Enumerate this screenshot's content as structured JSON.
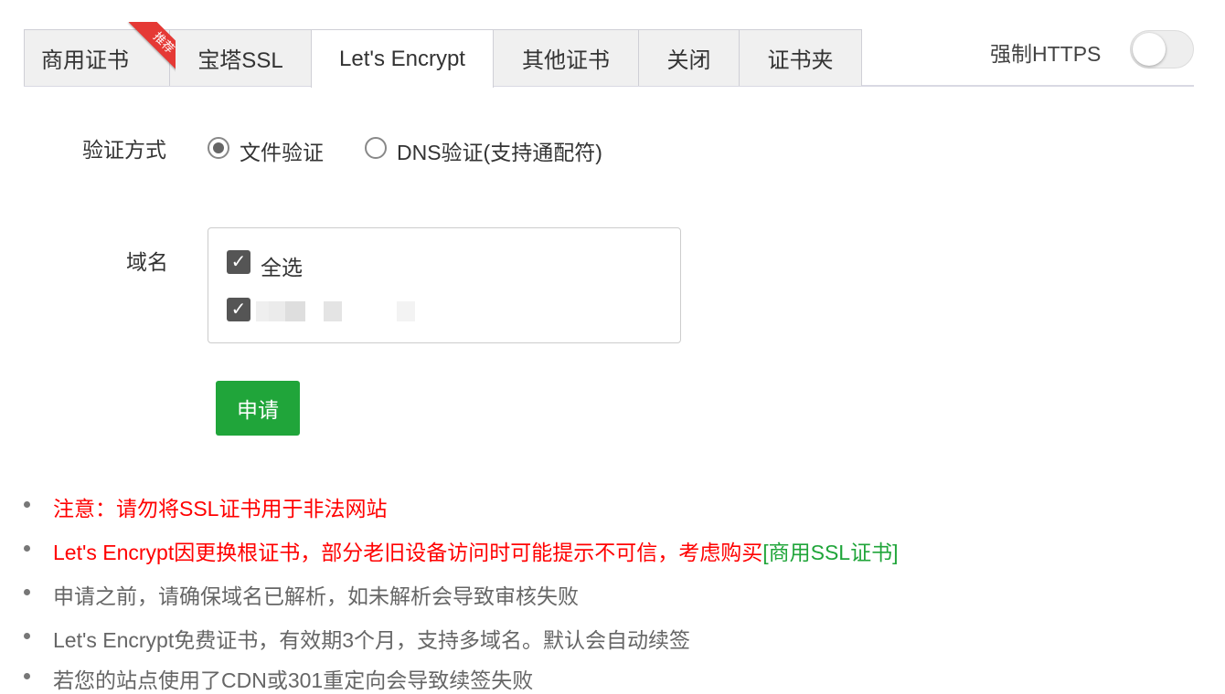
{
  "tabs": [
    {
      "label": "商用证书",
      "active": false,
      "ribbon": "推荐"
    },
    {
      "label": "宝塔SSL",
      "active": false
    },
    {
      "label": "Let's Encrypt",
      "active": true
    },
    {
      "label": "其他证书",
      "active": false
    },
    {
      "label": "关闭",
      "active": false
    },
    {
      "label": "证书夹",
      "active": false
    }
  ],
  "force_https": {
    "label": "强制HTTPS",
    "enabled": false
  },
  "verify": {
    "label": "验证方式",
    "options": [
      {
        "label": "文件验证",
        "checked": true
      },
      {
        "label": "DNS验证(支持通配符)",
        "checked": false
      }
    ]
  },
  "domain": {
    "label": "域名",
    "select_all": {
      "label": "全选",
      "checked": true
    },
    "items": [
      {
        "label": "",
        "checked": true
      }
    ]
  },
  "apply_button": "申请",
  "notes": [
    {
      "text": "注意：请勿将SSL证书用于非法网站",
      "style": "red"
    },
    {
      "text": "Let's Encrypt因更换根证书，部分老旧设备访问时可能提示不可信，考虑购买",
      "style": "red",
      "link": "[商用SSL证书]"
    },
    {
      "text": "申请之前，请确保域名已解析，如未解析会导致审核失败",
      "style": "gray"
    },
    {
      "text": "Let's Encrypt免费证书，有效期3个月，支持多域名。默认会自动续签",
      "style": "gray"
    },
    {
      "text": "若您的站点使用了CDN或301重定向会导致续签失败",
      "style": "gray"
    }
  ],
  "colors": {
    "accent": "#20a53a",
    "warning": "#ff0000",
    "ribbon": "#e53935"
  }
}
